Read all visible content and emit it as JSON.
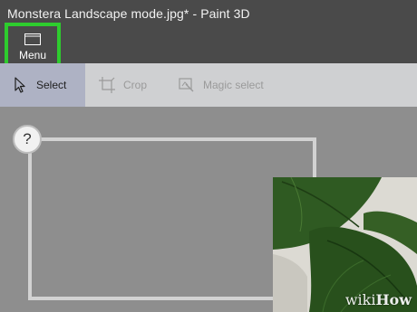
{
  "window": {
    "title": "Monstera Landscape mode.jpg* - Paint 3D"
  },
  "menu": {
    "label": "Menu",
    "icon": "folder-icon",
    "highlight_color": "#2ecc2e"
  },
  "toolbar": {
    "tools": [
      {
        "label": "Select",
        "icon": "cursor-arrow-icon",
        "active": true
      },
      {
        "label": "Crop",
        "icon": "crop-icon",
        "active": false
      },
      {
        "label": "Magic select",
        "icon": "magic-select-icon",
        "active": false
      }
    ]
  },
  "canvas": {
    "help_label": "?",
    "image_subject": "monstera leaves"
  },
  "watermark": {
    "part1": "wiki",
    "part2": "How"
  },
  "colors": {
    "titlebar": "#4a4a4a",
    "toolbar": "#cfd0d2",
    "active_tool": "#aeb2c4",
    "canvas": "#8e8e8e"
  }
}
